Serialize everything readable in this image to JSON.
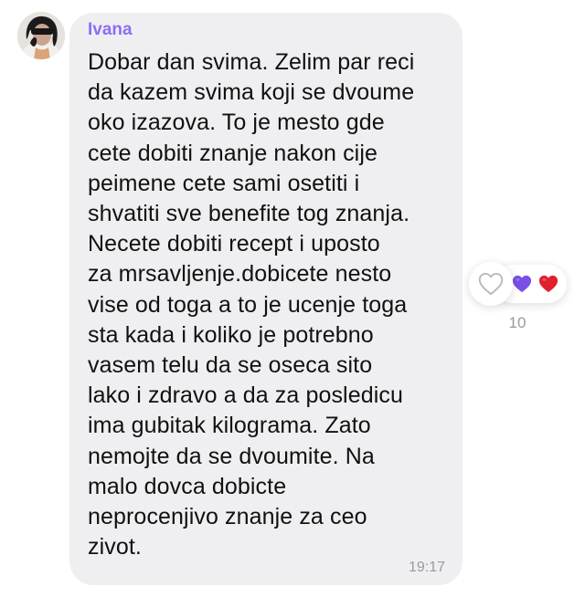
{
  "message": {
    "sender": "Ivana",
    "text": "Dobar dan svima. Zelim par reci\nda kazem svima koji se dvoume\noko izazova. To je mesto gde\ncete dobiti znanje nakon cije\npeimene cete sami osetiti i\nshvatiti sve benefite tog znanja.\nNecete dobiti recept i uposto\nza mrsavljenje.dobicete nesto\nvise od toga a to je ucenje toga\nsta kada i koliko je potrebno\nvasem telu da se oseca sito\nlako i zdravo a da za posledicu\nima gubitak kilograma. Zato\nnemojte da se dvoumite. Na\nmalo dovca dobicte\nneprocenjivo znanje za ceo\nzivot.",
    "time": "19:17"
  },
  "reactions": {
    "count": "10",
    "items": [
      "purple-heart",
      "red-heart"
    ]
  },
  "colors": {
    "sender_name": "#8c6ef5",
    "bubble_background": "#efeff1",
    "purple_heart": "#7a4fe8",
    "red_heart": "#e0202e"
  }
}
